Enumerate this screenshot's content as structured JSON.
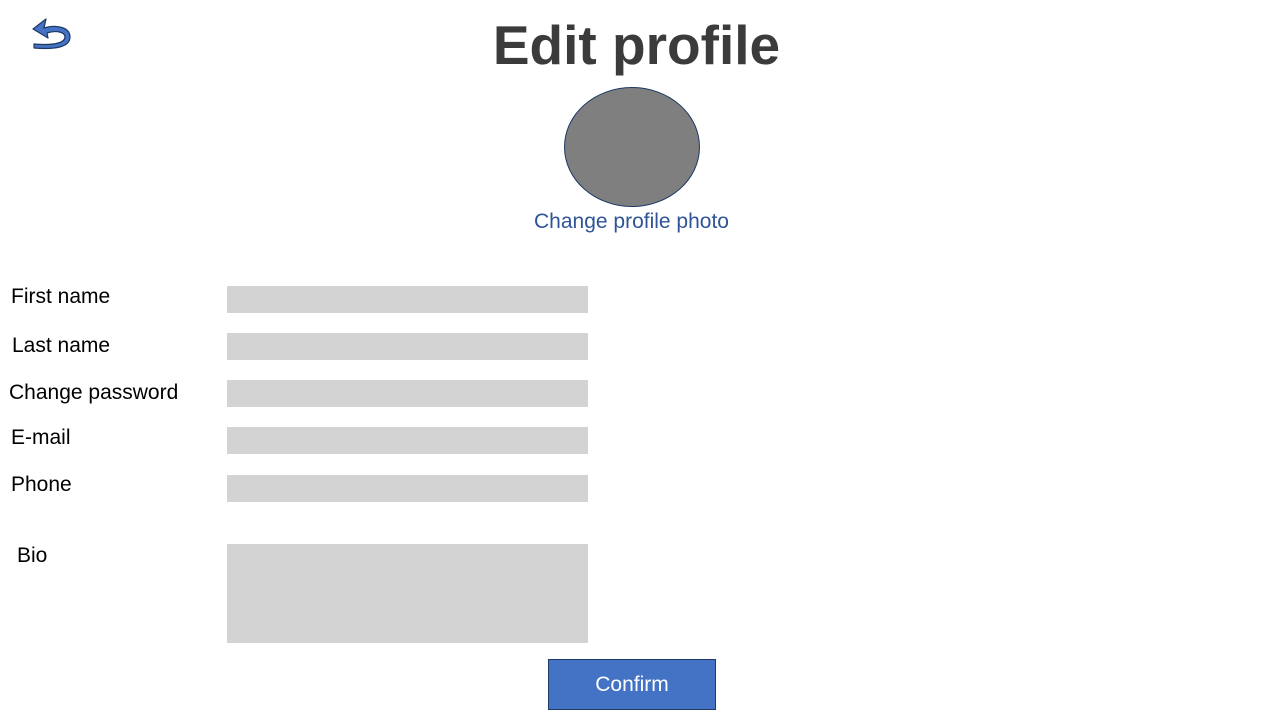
{
  "header": {
    "title": "Edit profile",
    "back_icon": "undo-arrow-icon"
  },
  "profile_photo": {
    "change_label": "Change profile photo",
    "avatar_color": "#7f7f7f"
  },
  "form": {
    "first_name": {
      "label": "First name",
      "value": "",
      "placeholder": ""
    },
    "last_name": {
      "label": "Last name",
      "value": "",
      "placeholder": ""
    },
    "password": {
      "label": "Change password",
      "value": "",
      "placeholder": ""
    },
    "email": {
      "label": "E-mail",
      "value": "",
      "placeholder": ""
    },
    "phone": {
      "label": "Phone",
      "value": "",
      "placeholder": ""
    },
    "bio": {
      "label": "Bio",
      "value": "",
      "placeholder": ""
    }
  },
  "actions": {
    "confirm_label": "Confirm"
  },
  "colors": {
    "title": "#3b3b3b",
    "link": "#2f5597",
    "field_bg": "#d3d3d3",
    "button_bg": "#4472c4",
    "button_border": "#1f3864",
    "back_icon": "#4472c4"
  }
}
